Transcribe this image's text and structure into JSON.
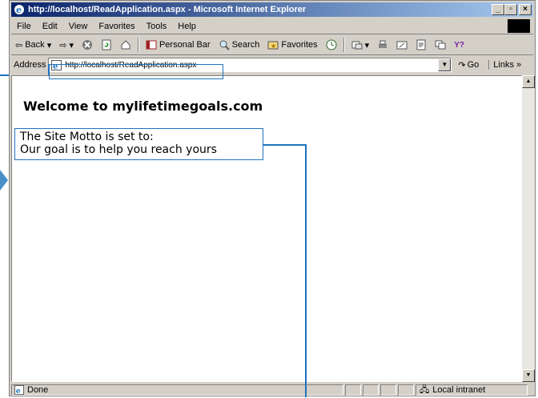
{
  "window": {
    "title": "http://localhost/ReadApplication.aspx - Microsoft Internet Explorer"
  },
  "menu": [
    "File",
    "Edit",
    "View",
    "Favorites",
    "Tools",
    "Help"
  ],
  "toolbar": {
    "back": "Back",
    "personal_bar": "Personal Bar",
    "search": "Search",
    "favorites": "Favorites"
  },
  "address": {
    "label": "Address",
    "url": "http://localhost/ReadApplication.aspx",
    "go": "Go",
    "links": "Links »"
  },
  "page": {
    "heading": "Welcome to mylifetimegoals.com",
    "motto_line1": "The Site Motto is set to:",
    "motto_line2": "Our goal is to help you reach yours"
  },
  "status": {
    "left": "Done",
    "zone": "Local intranet"
  },
  "colors": {
    "callout": "#1e73be",
    "titlebar": "#0a246a"
  }
}
